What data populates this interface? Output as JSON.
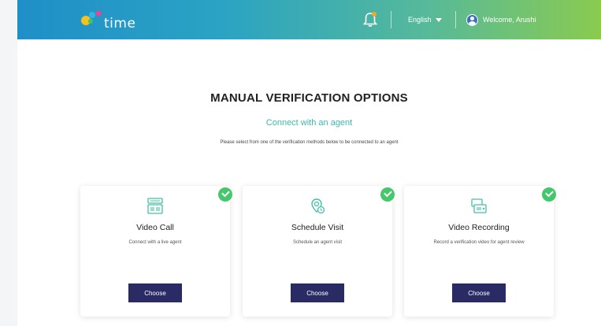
{
  "header": {
    "logo_text": "time",
    "language": "English",
    "welcome": "Welcome, Arushi"
  },
  "main": {
    "title": "MANUAL VERIFICATION OPTIONS",
    "subtitle": "Connect with an agent",
    "description": "Please select from one of the verification methods below to be connected to an agent"
  },
  "cards": [
    {
      "icon": "video-call-icon",
      "title": "Video Call",
      "description": "Connect with a live agent",
      "button": "Choose",
      "selected": true
    },
    {
      "icon": "schedule-visit-icon",
      "title": "Schedule Visit",
      "description": "Schedule an agent visit",
      "button": "Choose",
      "selected": true
    },
    {
      "icon": "video-recording-icon",
      "title": "Video Recording",
      "description": "Record a verification video for agent review",
      "button": "Choose",
      "selected": true
    }
  ],
  "colors": {
    "accent_teal": "#3bb8b0",
    "button_navy": "#2a2a64",
    "check_green": "#44c86b",
    "header_gradient_start": "#1f8fc7",
    "header_gradient_end": "#8acb4f"
  }
}
